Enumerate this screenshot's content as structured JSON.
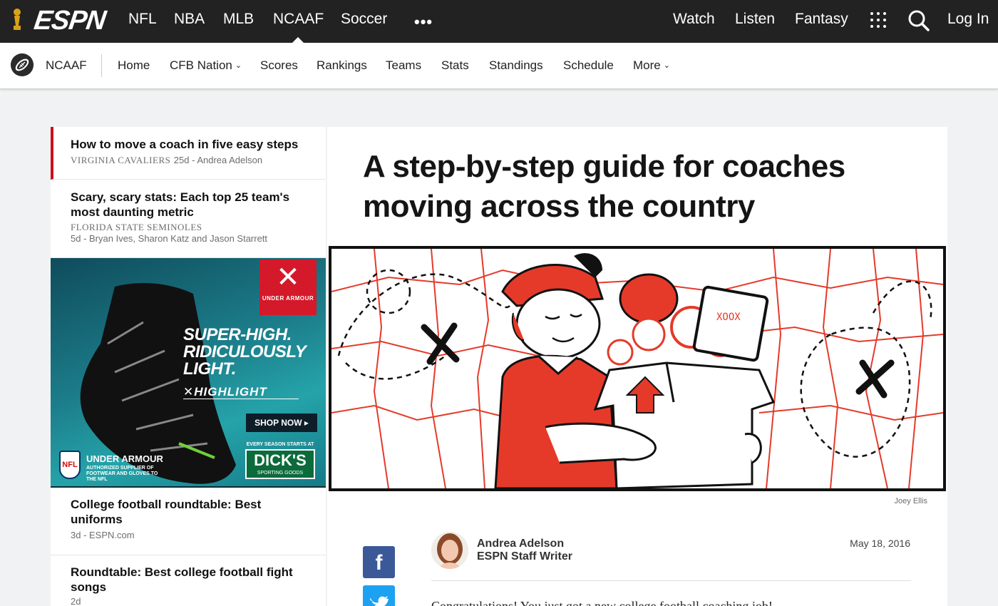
{
  "brand": {
    "logo_text": "ESPN"
  },
  "topnav": {
    "left_items": [
      "NFL",
      "NBA",
      "MLB",
      "NCAAF",
      "Soccer"
    ],
    "active": "NCAAF",
    "right_items": [
      "Watch",
      "Listen",
      "Fantasy"
    ],
    "login": "Log In"
  },
  "subnav": {
    "sport": "NCAAF",
    "links": [
      "Home",
      "CFB Nation",
      "Scores",
      "Rankings",
      "Teams",
      "Stats",
      "Standings",
      "Schedule",
      "More"
    ]
  },
  "sidebar": {
    "stories": [
      {
        "title": "How to move a coach in five easy steps",
        "team": "VIRGINIA CAVALIERS",
        "meta": "25d - Andrea Adelson"
      },
      {
        "title": "Scary, scary stats: Each top 25 team's most daunting metric",
        "team": "FLORIDA STATE SEMINOLES",
        "meta": "5d - Bryan Ives, Sharon Katz and Jason Starrett"
      },
      {
        "title": "College football roundtable: Best uniforms",
        "team": "",
        "meta": "3d - ESPN.com"
      },
      {
        "title": "Roundtable: Best college football fight songs",
        "team": "",
        "meta": "2d"
      }
    ]
  },
  "ad": {
    "brand": "UNDER ARMOUR",
    "headline": [
      "SUPER-HIGH.",
      "RIDICULOUSLY",
      "LIGHT."
    ],
    "product": "✕HIGHLIGHT",
    "cta": "SHOP NOW",
    "supplier_title": "UNDER ARMOUR",
    "supplier_text": "AUTHORIZED SUPPLIER OF FOOTWEAR AND GLOVES TO THE NFL",
    "nfl": "NFL",
    "retailer_tag": "EVERY SEASON STARTS AT",
    "retailer": "DICK'S",
    "retailer_sub": "SPORTING GOODS"
  },
  "article": {
    "headline": "A step-by-step guide for coaches moving across the country",
    "image_credit": "Joey Ellis",
    "author": "Andrea Adelson",
    "author_role": "ESPN Staff Writer",
    "date": "May 18, 2016",
    "body_start": "Congratulations! You just got a new college football coaching job!"
  },
  "colors": {
    "espn_red": "#cc0e1e",
    "nav_bg": "#222222",
    "facebook": "#3b5998",
    "twitter": "#1da1f2"
  }
}
